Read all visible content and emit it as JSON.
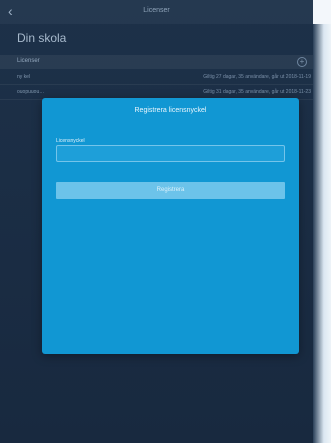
{
  "nav": {
    "title": "Licenser",
    "back_glyph": "‹"
  },
  "school": {
    "title": "Din skola"
  },
  "section": {
    "label": "Licenser",
    "add_glyph": "+"
  },
  "licenses": [
    {
      "name": "ny kel",
      "info": "Giltig 27 dagar, 35 användare, går ut 2018-11-19"
    },
    {
      "name": "ouopuuou…",
      "info": "Giltig 31 dagar, 35 användare, går ut 2018-11-23"
    }
  ],
  "modal": {
    "title": "Registrera licensnyckel",
    "field_label": "Licensnyckel",
    "field_value": "",
    "button_label": "Registrera"
  },
  "colors": {
    "modal": "#1197d3",
    "button": "#6cc3ea",
    "background": "#1c2f45"
  }
}
